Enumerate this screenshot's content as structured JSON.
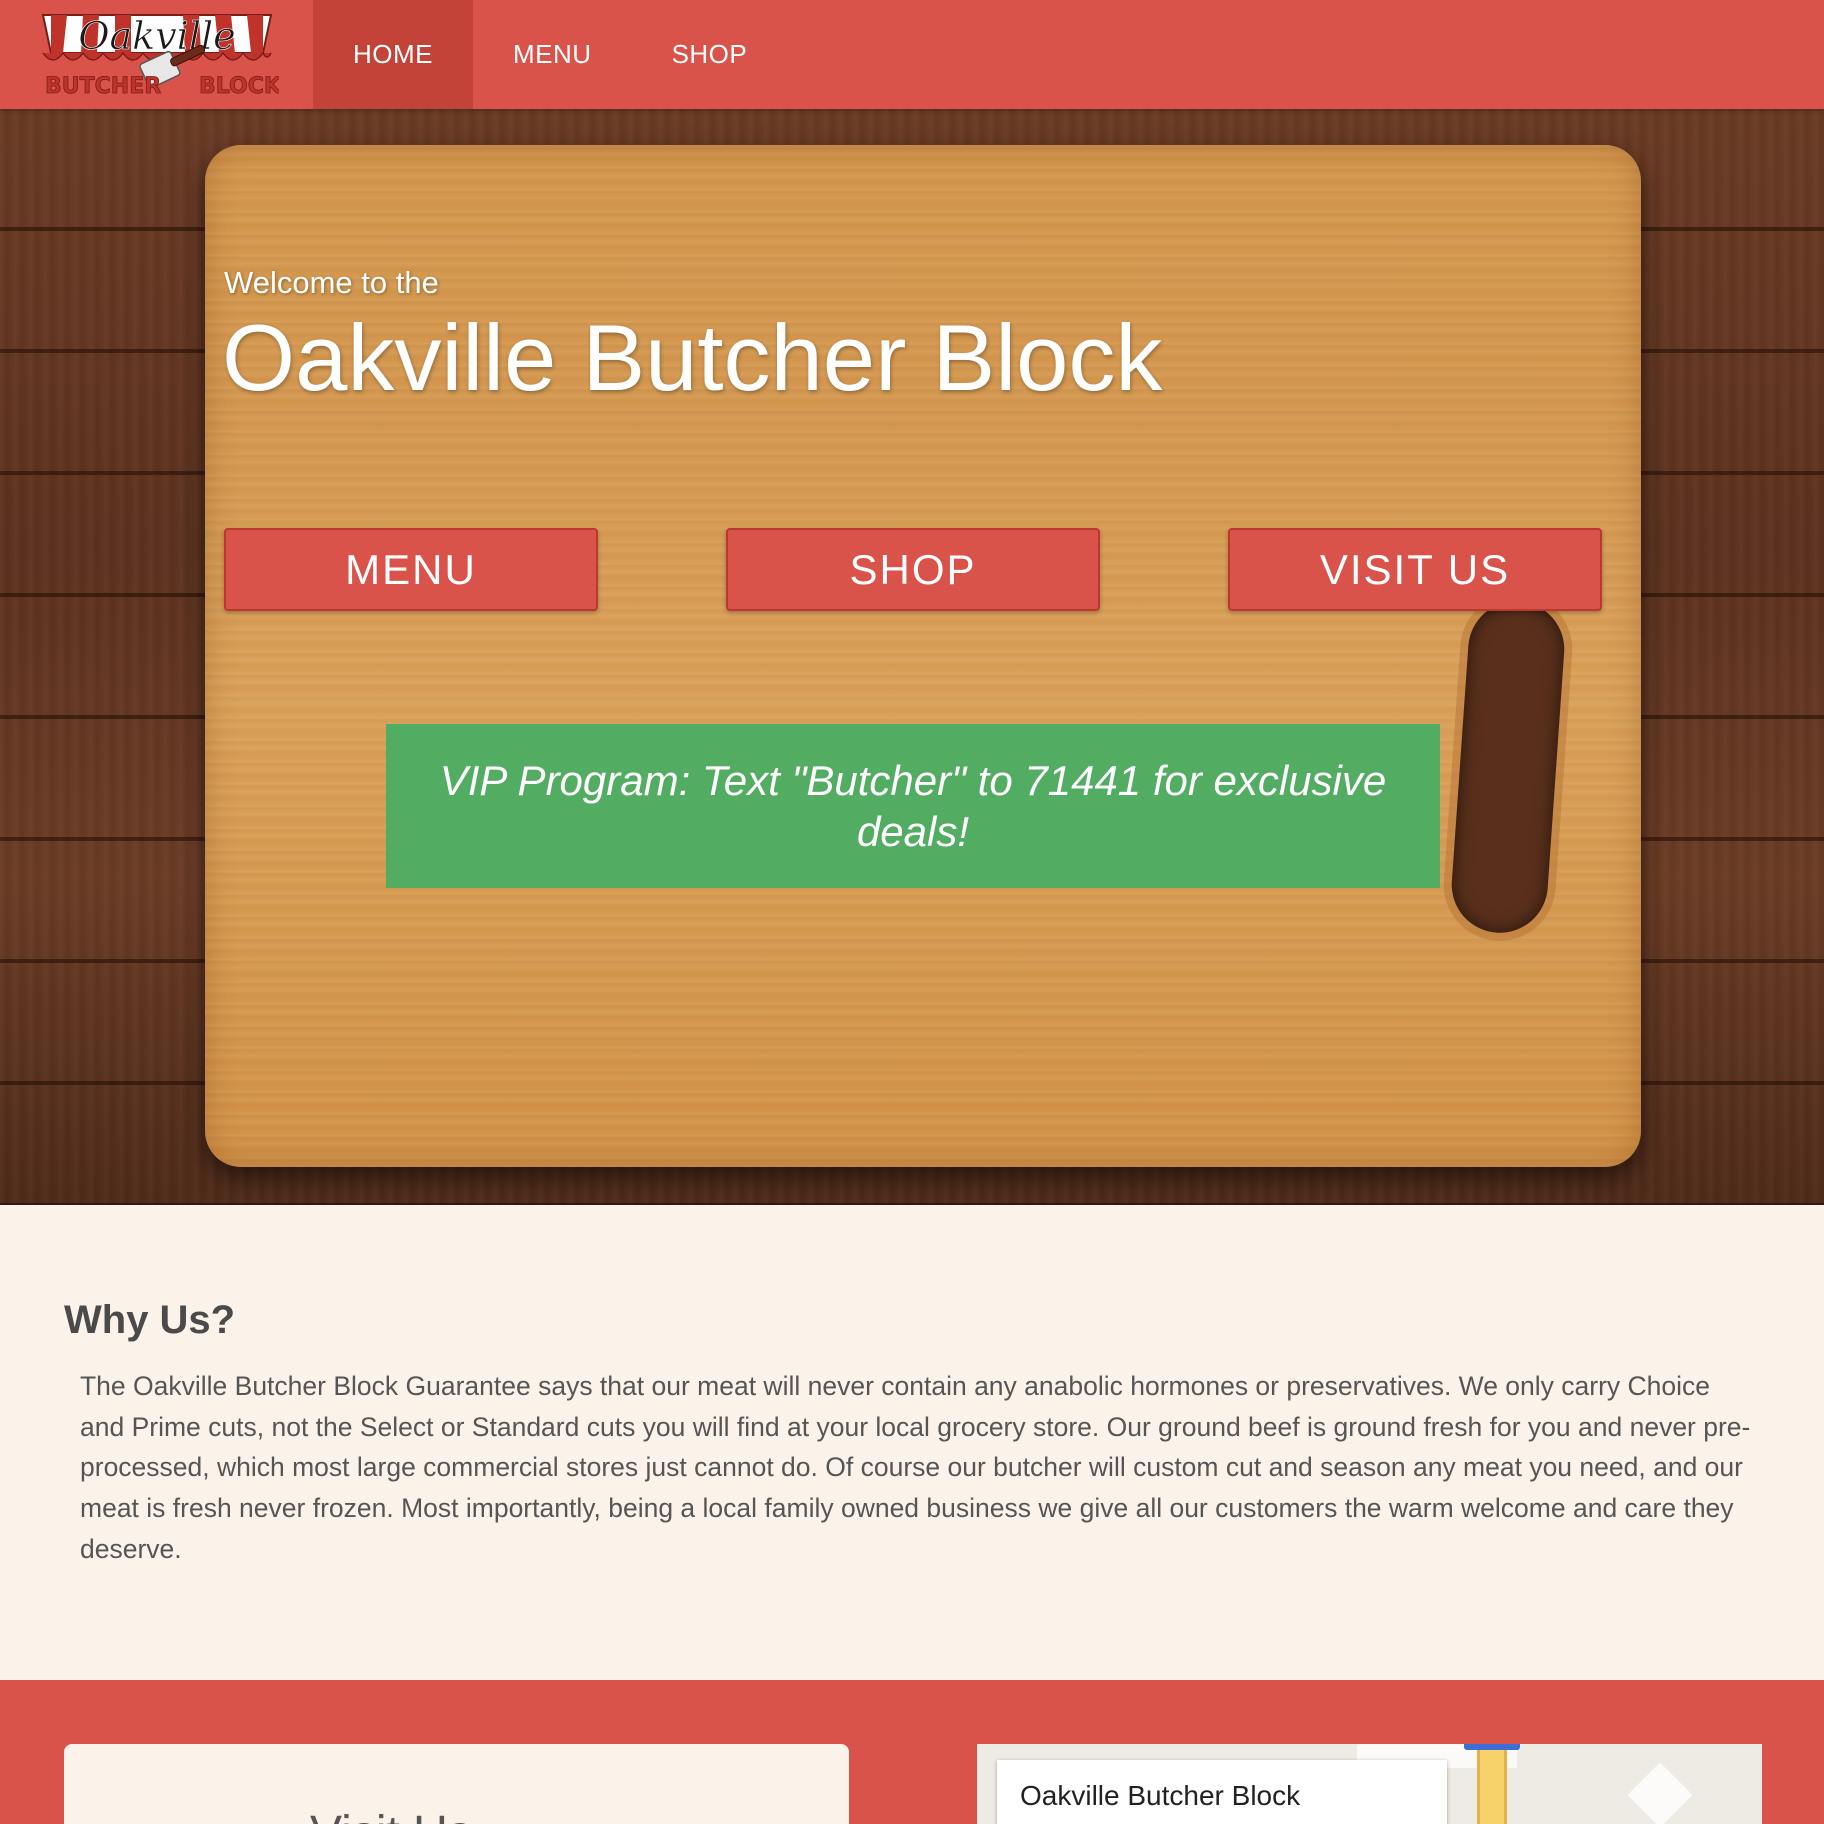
{
  "nav": {
    "logo_alt": "Oakville Butcher Block",
    "items": [
      {
        "label": "HOME",
        "active": true
      },
      {
        "label": "MENU",
        "active": false
      },
      {
        "label": "SHOP",
        "active": false
      }
    ]
  },
  "hero": {
    "welcome": "Welcome to the",
    "title": "Oakville Butcher Block",
    "buttons": {
      "menu": "MENU",
      "shop": "SHOP",
      "visit": "VISIT US"
    },
    "vip": "VIP Program: Text \"Butcher\" to 71441 for exclusive deals!"
  },
  "why": {
    "heading": "Why Us?",
    "body": "The Oakville Butcher Block Guarantee says that our meat will never contain any anabolic hormones or preservatives. We only carry Choice and Prime cuts, not the Select or Standard cuts you will find at your local grocery store. Our ground beef is ground fresh for you and never pre-processed, which most large commercial stores just cannot do. Of course our butcher will custom cut and season any meat you need, and our meat is fresh never frozen. Most importantly, being a local family owned business we give all our customers the warm welcome and care they deserve."
  },
  "visit": {
    "card_title": "Visit Us",
    "map_place_name": "Oakville Butcher Block"
  },
  "colors": {
    "brand_red": "#d9534a",
    "brand_red_dark": "#c44339",
    "vip_green": "#52ad63",
    "cream": "#fbf3ea"
  }
}
